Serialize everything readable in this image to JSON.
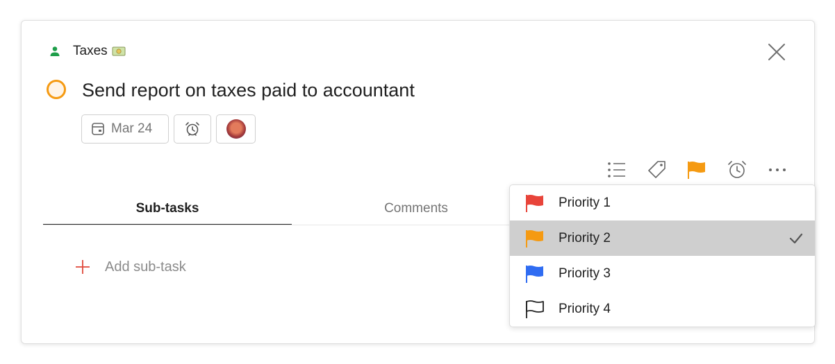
{
  "header": {
    "project_name": "Taxes",
    "project_emoji": "money-with-wings-icon"
  },
  "task": {
    "title": "Send report on taxes paid to accountant",
    "due_label": "Mar 24"
  },
  "toolbar": [
    "subtasks-list-icon",
    "label-tag-icon",
    "priority-flag-icon",
    "reminder-alarm-icon",
    "more-icon"
  ],
  "tabs": {
    "subtasks": "Sub-tasks",
    "comments": "Comments"
  },
  "add_subtask": {
    "label": "Add sub-task"
  },
  "priority_menu": {
    "options": [
      {
        "label": "Priority 1",
        "color": "#e8443a",
        "selected": false
      },
      {
        "label": "Priority 2",
        "color": "#f59a12",
        "selected": true
      },
      {
        "label": "Priority 3",
        "color": "#2f6cf2",
        "selected": false
      },
      {
        "label": "Priority 4",
        "color": "#202020",
        "selected": false
      }
    ]
  },
  "colors": {
    "accent_orange": "#f59a12",
    "project_green": "#1e9e4a",
    "add_red": "#e0483a"
  }
}
